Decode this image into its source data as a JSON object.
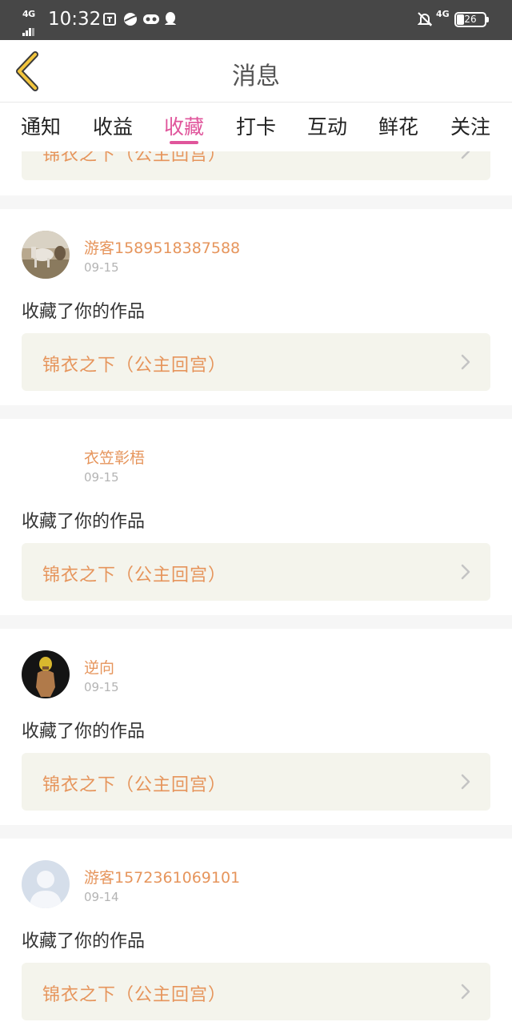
{
  "status_bar": {
    "network_left": "4G",
    "time": "10:32",
    "network_right": "4G",
    "battery": "26"
  },
  "nav": {
    "title": "消息",
    "back_icon": "chevron-left-icon"
  },
  "tabs": [
    {
      "label": "通知"
    },
    {
      "label": "收益"
    },
    {
      "label": "收藏",
      "active": true
    },
    {
      "label": "打卡"
    },
    {
      "label": "互动"
    },
    {
      "label": "鲜花"
    },
    {
      "label": "关注"
    }
  ],
  "colors": {
    "accent": "#e0559b",
    "name": "#e6955c",
    "work_bg": "#f4f4ec"
  },
  "partial_card": {
    "work_title": "锦衣之下（公主回宫）"
  },
  "cards": [
    {
      "username": "游客1589518387588",
      "date": "09-15",
      "message": "收藏了你的作品",
      "work_title": "锦衣之下（公主回宫）",
      "avatar": "horse-photo-avatar"
    },
    {
      "username": "衣笠彰梧",
      "date": "09-15",
      "message": "收藏了你的作品",
      "work_title": "锦衣之下（公主回宫）",
      "avatar": "blank-avatar"
    },
    {
      "username": "逆向",
      "date": "09-15",
      "message": "收藏了你的作品",
      "work_title": "锦衣之下（公主回宫）",
      "avatar": "figure-photo-avatar"
    },
    {
      "username": "游客1572361069101",
      "date": "09-14",
      "message": "收藏了你的作品",
      "work_title": "锦衣之下（公主回宫）",
      "avatar": "default-person-avatar"
    }
  ]
}
